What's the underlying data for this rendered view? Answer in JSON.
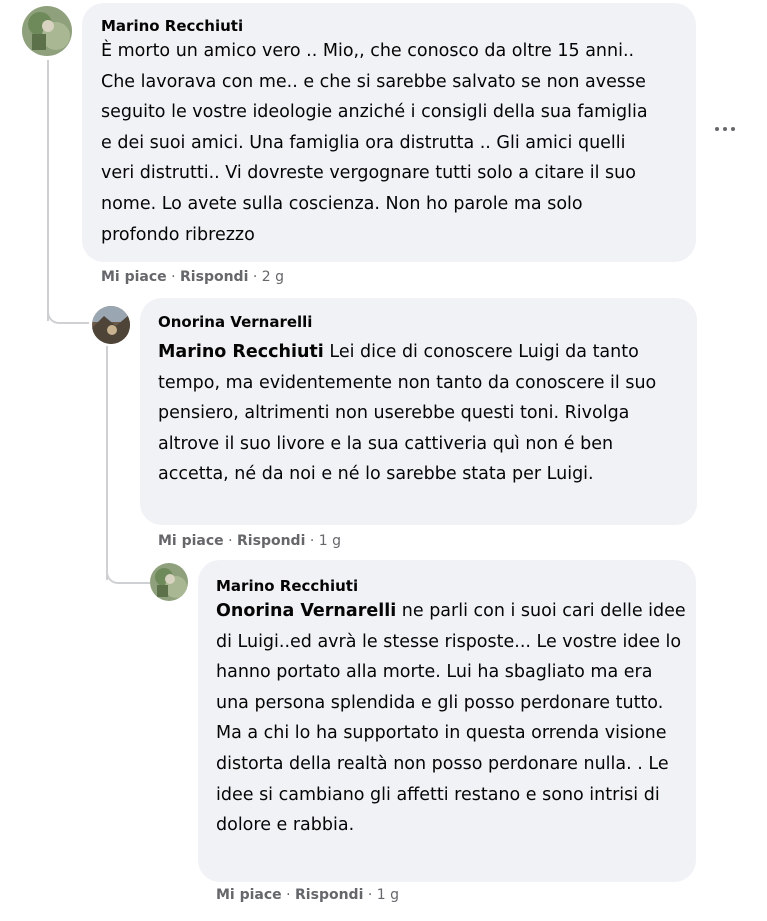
{
  "comments": [
    {
      "author": "Marino Recchiuti",
      "mention": "",
      "text": "È morto un amico vero .. Mio,, che conosco da oltre 15 anni.. Che lavorava con me.. e che si sarebbe salvato se non avesse seguito le vostre ideologie anziché i consigli della sua famiglia e dei suoi amici. Una famiglia ora distrutta .. Gli amici quelli veri distrutti.. Vi dovreste vergognare tutti solo a citare il suo nome. Lo avete sulla coscienza. Non ho parole ma solo profondo ribrezzo",
      "like": "Mi piace",
      "reply": "Rispondi",
      "time": "2 g"
    },
    {
      "author": "Onorina Vernarelli",
      "mention": "Marino Recchiuti",
      "text": "Lei dice di conoscere Luigi da tanto tempo, ma evidentemente non tanto da conoscere il suo pensiero, altrimenti non userebbe questi toni. Rivolga altrove il suo livore e la sua cattiveria quì non é ben accetta, né da noi e né lo sarebbe stata per Luigi.",
      "like": "Mi piace",
      "reply": "Rispondi",
      "time": "1 g"
    },
    {
      "author": "Marino Recchiuti",
      "mention": "Onorina Vernarelli",
      "text": "ne parli con i suoi cari delle idee di Luigi..ed avrà le stesse risposte... Le vostre idee lo hanno portato alla morte. Lui ha sbagliato ma era una persona splendida e gli posso perdonare tutto. Ma a chi lo ha supportato in questa orrenda visione distorta della realtà non posso perdonare nulla. . Le idee si cambiano gli affetti restano e sono intrisi di dolore e rabbia.",
      "like": "Mi piace",
      "reply": "Rispondi",
      "time": "1 g"
    }
  ],
  "separator": " · ",
  "more_icon": "more-horizontal-icon"
}
